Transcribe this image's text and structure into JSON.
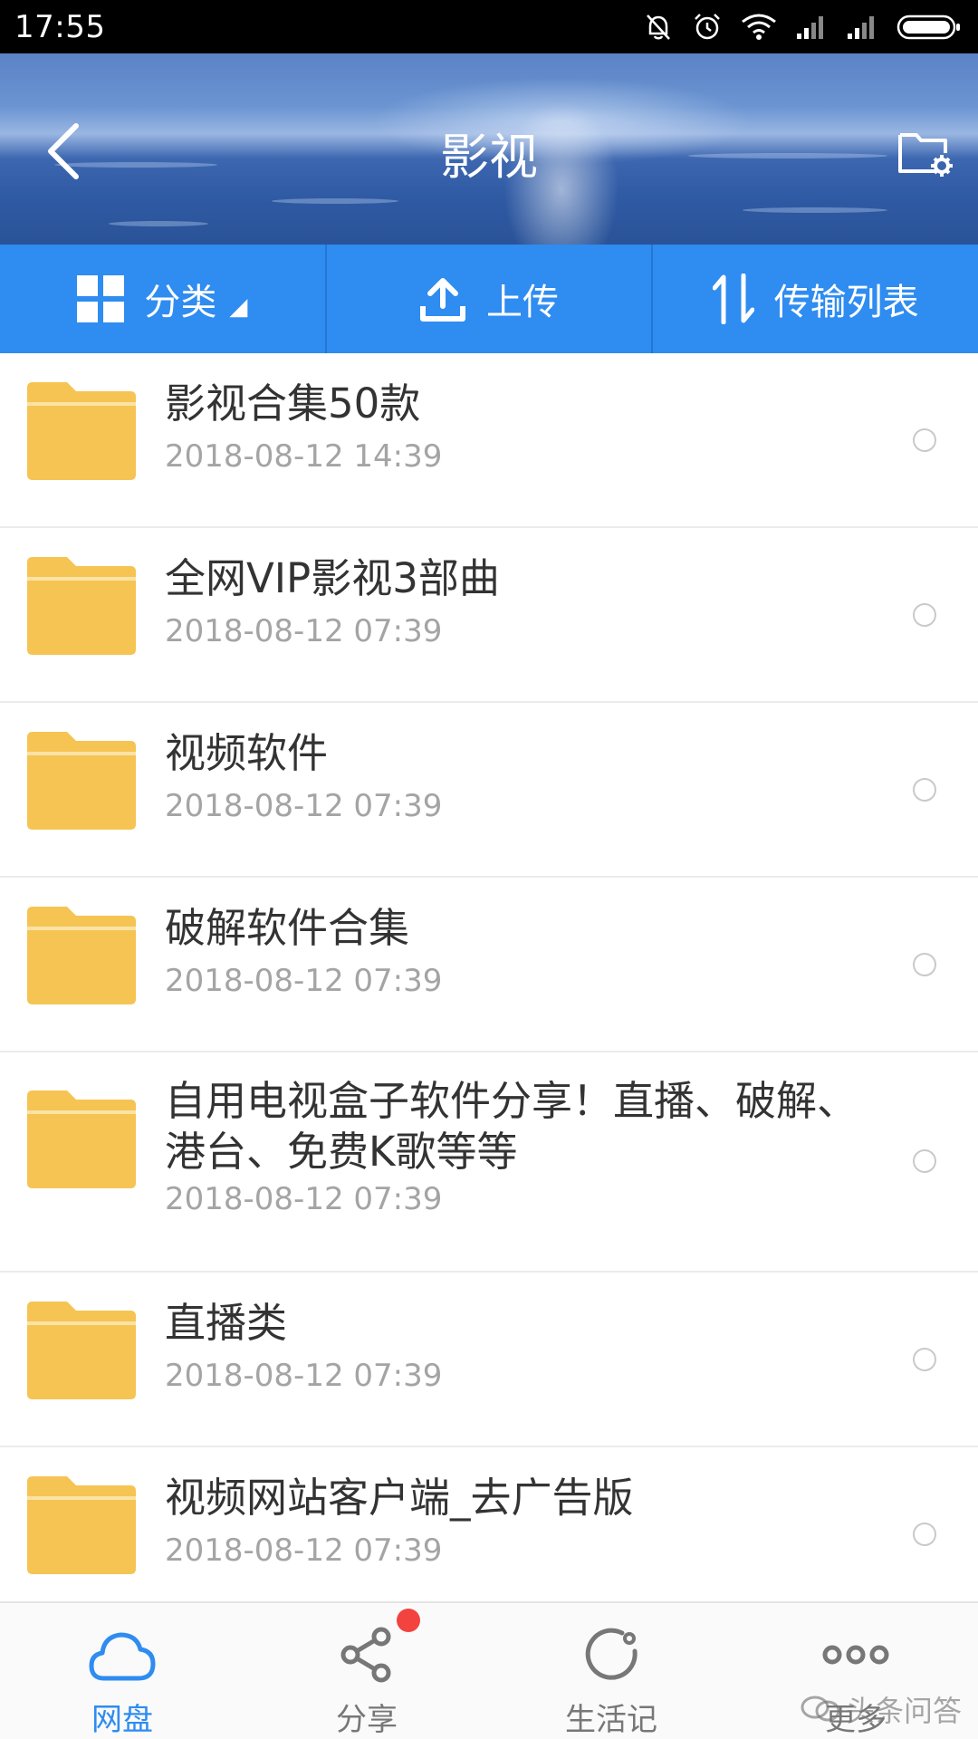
{
  "status_bar": {
    "time": "17:55",
    "icons": [
      "mute-bell-icon",
      "alarm-icon",
      "wifi-icon",
      "signal-icon",
      "signal-icon",
      "battery-icon"
    ]
  },
  "header": {
    "title": "影视",
    "back_icon": "chevron-left-icon",
    "settings_icon": "folder-settings-icon"
  },
  "toolbar": {
    "category_label": "分类",
    "category_caret": "◢",
    "upload_label": "上传",
    "transfer_label": "传输列表"
  },
  "files": [
    {
      "name": "影视合集50款",
      "date": "2018-08-12  14:39"
    },
    {
      "name": "全网VIP影视3部曲",
      "date": "2018-08-12  07:39"
    },
    {
      "name": "视频软件",
      "date": "2018-08-12  07:39"
    },
    {
      "name": "破解软件合集",
      "date": "2018-08-12  07:39"
    },
    {
      "name": "自用电视盒子软件分享！直播、破解、港台、免费K歌等等",
      "date": "2018-08-12  07:39"
    },
    {
      "name": "直播类",
      "date": "2018-08-12  07:39"
    },
    {
      "name": "视频网站客户端_去广告版",
      "date": "2018-08-12  07:39"
    }
  ],
  "nav": {
    "items": [
      {
        "label": "网盘",
        "icon": "cloud-icon",
        "active": true
      },
      {
        "label": "分享",
        "icon": "share-icon",
        "badge": true
      },
      {
        "label": "生活记",
        "icon": "refresh-circle-icon"
      },
      {
        "label": "更多",
        "icon": "more-dots-icon"
      }
    ]
  },
  "watermark": "头条问答",
  "colors": {
    "accent": "#2f8cf0",
    "folder": "#f5c453",
    "badge": "#f2433f"
  }
}
